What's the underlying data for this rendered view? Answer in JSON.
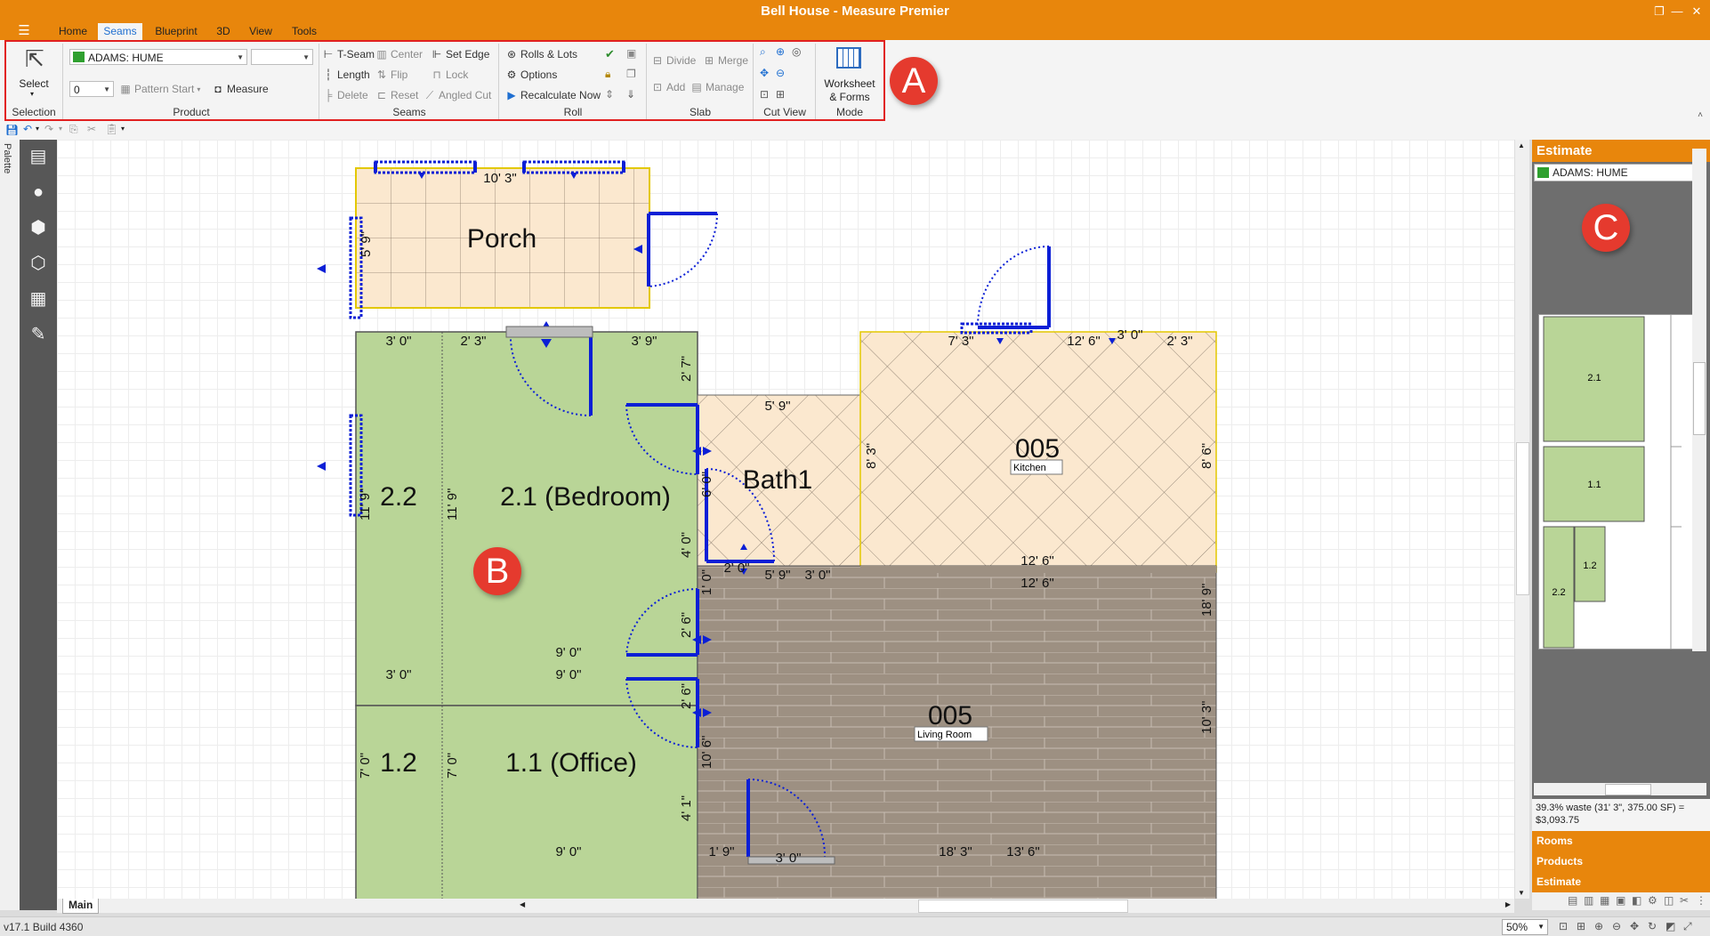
{
  "app": {
    "title": "Bell House - Measure Premier",
    "version": "v17.1 Build 4360",
    "zoom": "50%"
  },
  "menu": {
    "tabs": [
      {
        "label": "Home",
        "active": false
      },
      {
        "label": "Seams",
        "active": true
      },
      {
        "label": "Blueprint",
        "active": false
      },
      {
        "label": "3D",
        "active": false
      },
      {
        "label": "View",
        "active": false
      },
      {
        "label": "Tools",
        "active": false
      }
    ]
  },
  "ribbon": {
    "selection": {
      "select_label": "Select",
      "group": "Selection"
    },
    "product": {
      "product_value": "ADAMS: HUME",
      "product_color": "#2fa02f",
      "number_value": "0",
      "pattern_start": "Pattern Start",
      "measure": "Measure",
      "group": "Product"
    },
    "seams": {
      "t_seam": "T-Seam",
      "center": "Center",
      "set_edge": "Set Edge",
      "length": "Length",
      "flip": "Flip",
      "lock": "Lock",
      "delete": "Delete",
      "reset": "Reset",
      "angled_cut": "Angled Cut",
      "group": "Seams"
    },
    "roll": {
      "rolls_lots": "Rolls & Lots",
      "options": "Options",
      "recalculate": "Recalculate Now",
      "group": "Roll"
    },
    "slab": {
      "divide": "Divide",
      "merge": "Merge",
      "add": "Add",
      "manage": "Manage",
      "group": "Slab"
    },
    "cutview": {
      "group": "Cut View"
    },
    "mode": {
      "worksheet": "Worksheet",
      "forms": "& Forms",
      "group": "Mode"
    }
  },
  "palette": {
    "label": "Palette"
  },
  "canvas": {
    "tab": "Main",
    "rooms": {
      "porch": "Porch",
      "bedroom": "2.1 (Bedroom)",
      "bedroom_seam": "2.2",
      "office": "1.1 (Office)",
      "office_seam": "1.2",
      "bath": "Bath1",
      "kitchen_num": "005",
      "kitchen_tag": "Kitchen",
      "living_num": "005",
      "living_tag": "Living Room"
    },
    "dims": {
      "porch_top": "10' 3\"",
      "porch_side": "5' 9\"",
      "bed_3": "3' 0\"",
      "bed_2_3": "2' 3\"",
      "bed_3_9": "3' 9\"",
      "bed_2_7": "2' 7\"",
      "bed_11_9a": "11' 9\"",
      "bed_11_9b": "11' 9\"",
      "bed_6": "6' 0\"",
      "bed_4": "4' 0\"",
      "bed_9": "9' 0\"",
      "off_3": "3' 0\"",
      "off_9": "9' 0\"",
      "off_7a": "7' 0\"",
      "off_7b": "7' 0\"",
      "off_9b": "9' 0\"",
      "off_10_6": "10' 6\"",
      "off_4_1": "4' 1\"",
      "bath_5_9": "5' 9\"",
      "bath_5_9b": "5' 9\"",
      "bath_3": "3' 0\"",
      "bath_2": "2' 0\"",
      "kit_7_3": "7' 3\"",
      "kit_12_6": "12' 6\"",
      "kit_3": "3' 0\"",
      "kit_2_3": "2' 3\"",
      "kit_8_3": "8' 3\"",
      "kit_8_6": "8' 6\"",
      "kit_12_6b": "12' 6\"",
      "liv_12_6": "12' 6\"",
      "liv_18_9": "18' 9\"",
      "liv_10_3": "10' 3\"",
      "liv_1_9": "1' 9\"",
      "liv_3": "3' 0\"",
      "liv_18_3": "18' 3\"",
      "liv_13_6": "13' 6\"",
      "door_1": "1' 0\"",
      "door_2a": "2' 6\"",
      "door_2b": "2' 6\""
    }
  },
  "estimate": {
    "title": "Estimate",
    "product": "ADAMS: HUME",
    "pieces": {
      "p21": "2.1",
      "p11": "1.1",
      "p12": "1.2",
      "p22": "2.2"
    },
    "waste_line1": "39.3% waste (31' 3\", 375.00 SF) =",
    "waste_line2": "$3,093.75",
    "nav": [
      "Rooms",
      "Products",
      "Estimate"
    ]
  },
  "markers": {
    "a": "A",
    "b": "B",
    "c": "C"
  },
  "colors": {
    "accent": "#e8860c",
    "carpet": "#b9d597",
    "tile": "#fbe8cf",
    "wood": "#9d9082",
    "door_blue": "#0b1fd6",
    "marker_red": "#e53a2e"
  }
}
